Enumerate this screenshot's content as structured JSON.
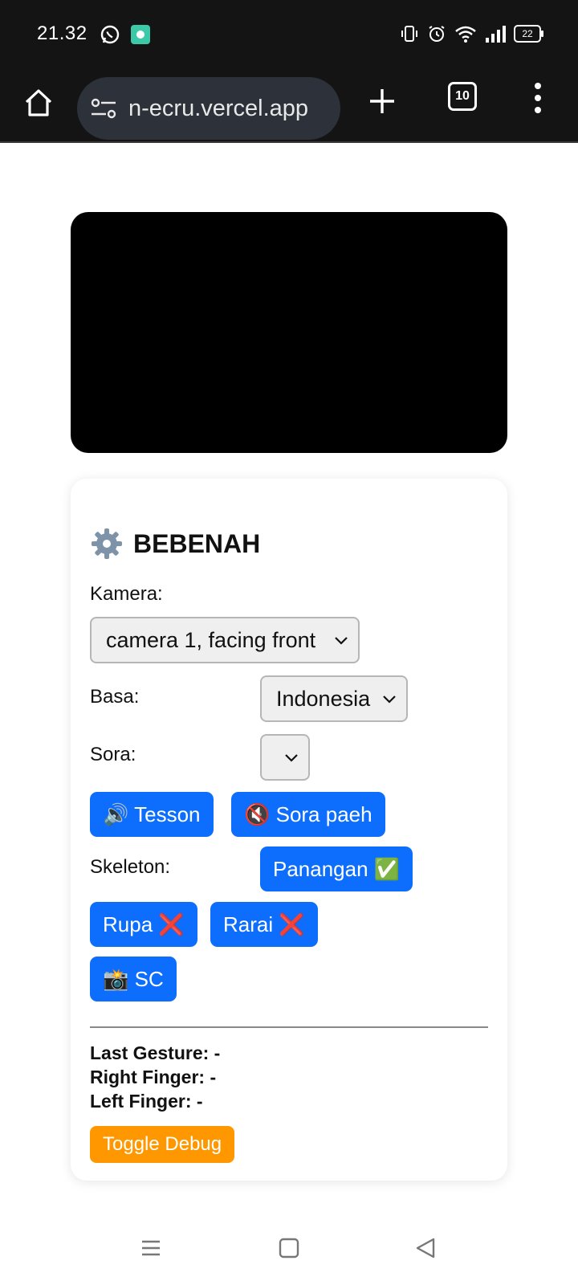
{
  "status_bar": {
    "time": "21.32",
    "battery": "22",
    "icons": [
      "whatsapp-icon",
      "app-notification-icon",
      "vibrate-icon",
      "alarm-icon",
      "wifi-icon",
      "signal-icon",
      "battery-icon"
    ]
  },
  "browser": {
    "url": "n-ecru.vercel.app",
    "tab_count": "10"
  },
  "settings": {
    "title": "BEBENAH",
    "camera_label": "Kamera:",
    "camera_value": "camera 1, facing front",
    "language_label": "Basa:",
    "language_value": "Indonesia",
    "voice_label": "Sora:",
    "voice_value": "",
    "test_button": "🔊 Tesson",
    "mute_button": "🔇 Sora paeh",
    "skeleton_label": "Skeleton:",
    "hand_button": "Panangan ✅",
    "face_button": "Rupa ❌",
    "body_button": "Rarai ❌",
    "screenshot_button": "📸 SC"
  },
  "stats": {
    "last_gesture_label": "Last Gesture:",
    "last_gesture_value": "-",
    "right_finger_label": "Right Finger:",
    "right_finger_value": "-",
    "left_finger_label": "Left Finger:",
    "left_finger_value": "-"
  },
  "debug_button": "Toggle Debug",
  "colors": {
    "primary_button": "#0d6efd",
    "debug_button": "#ff9800",
    "system_bar": "#141414",
    "url_bar": "#2c313a"
  }
}
